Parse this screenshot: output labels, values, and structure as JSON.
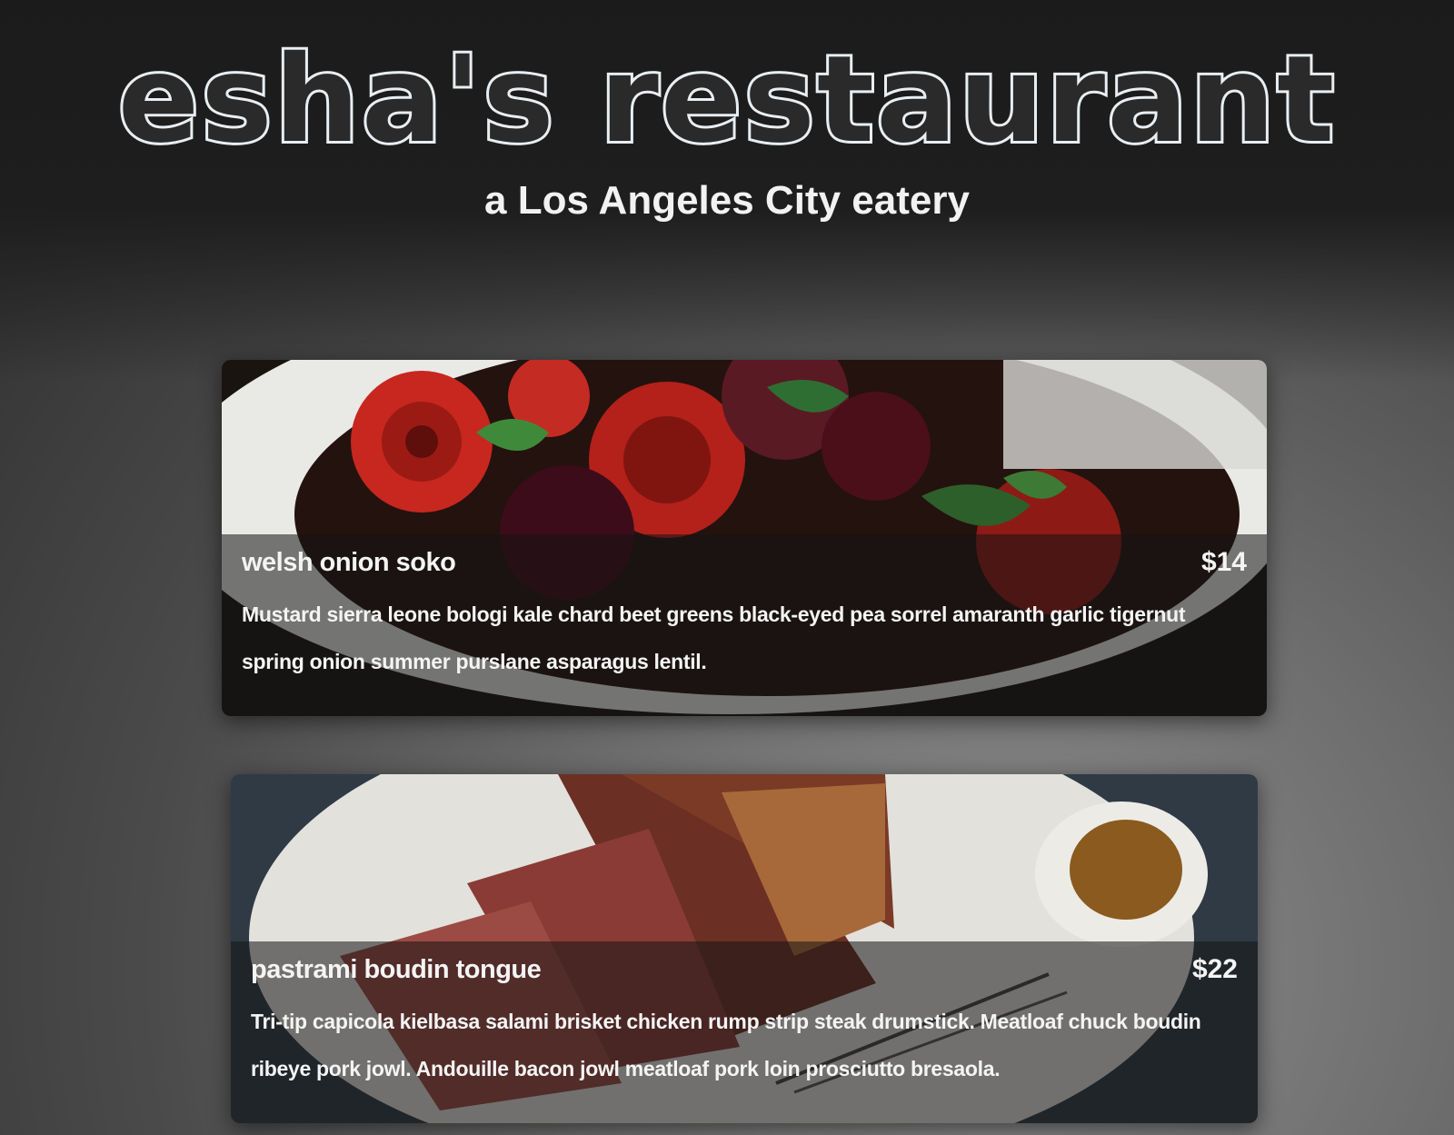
{
  "header": {
    "title": "esha's restaurant",
    "subtitle": "a Los Angeles City eatery"
  },
  "menu": {
    "items": [
      {
        "name": "welsh onion soko",
        "price": "$14",
        "description": "Mustard sierra leone bologi kale chard beet greens black-eyed pea sorrel amaranth garlic tigernut spring onion summer purslane asparagus lentil.",
        "image": "roasted-vegetables-photo"
      },
      {
        "name": "pastrami boudin tongue",
        "price": "$22",
        "description": "Tri-tip capicola kielbasa salami brisket chicken rump strip steak drumstick. Meatloaf chuck boudin ribeye pork jowl. Andouille bacon jowl meatloaf pork loin prosciutto bresaola.",
        "image": "sliced-steak-photo"
      }
    ]
  },
  "colors": {
    "background": "#4b4b4b",
    "title_outline": "#e8eef2",
    "text": "#f4f4f4"
  }
}
